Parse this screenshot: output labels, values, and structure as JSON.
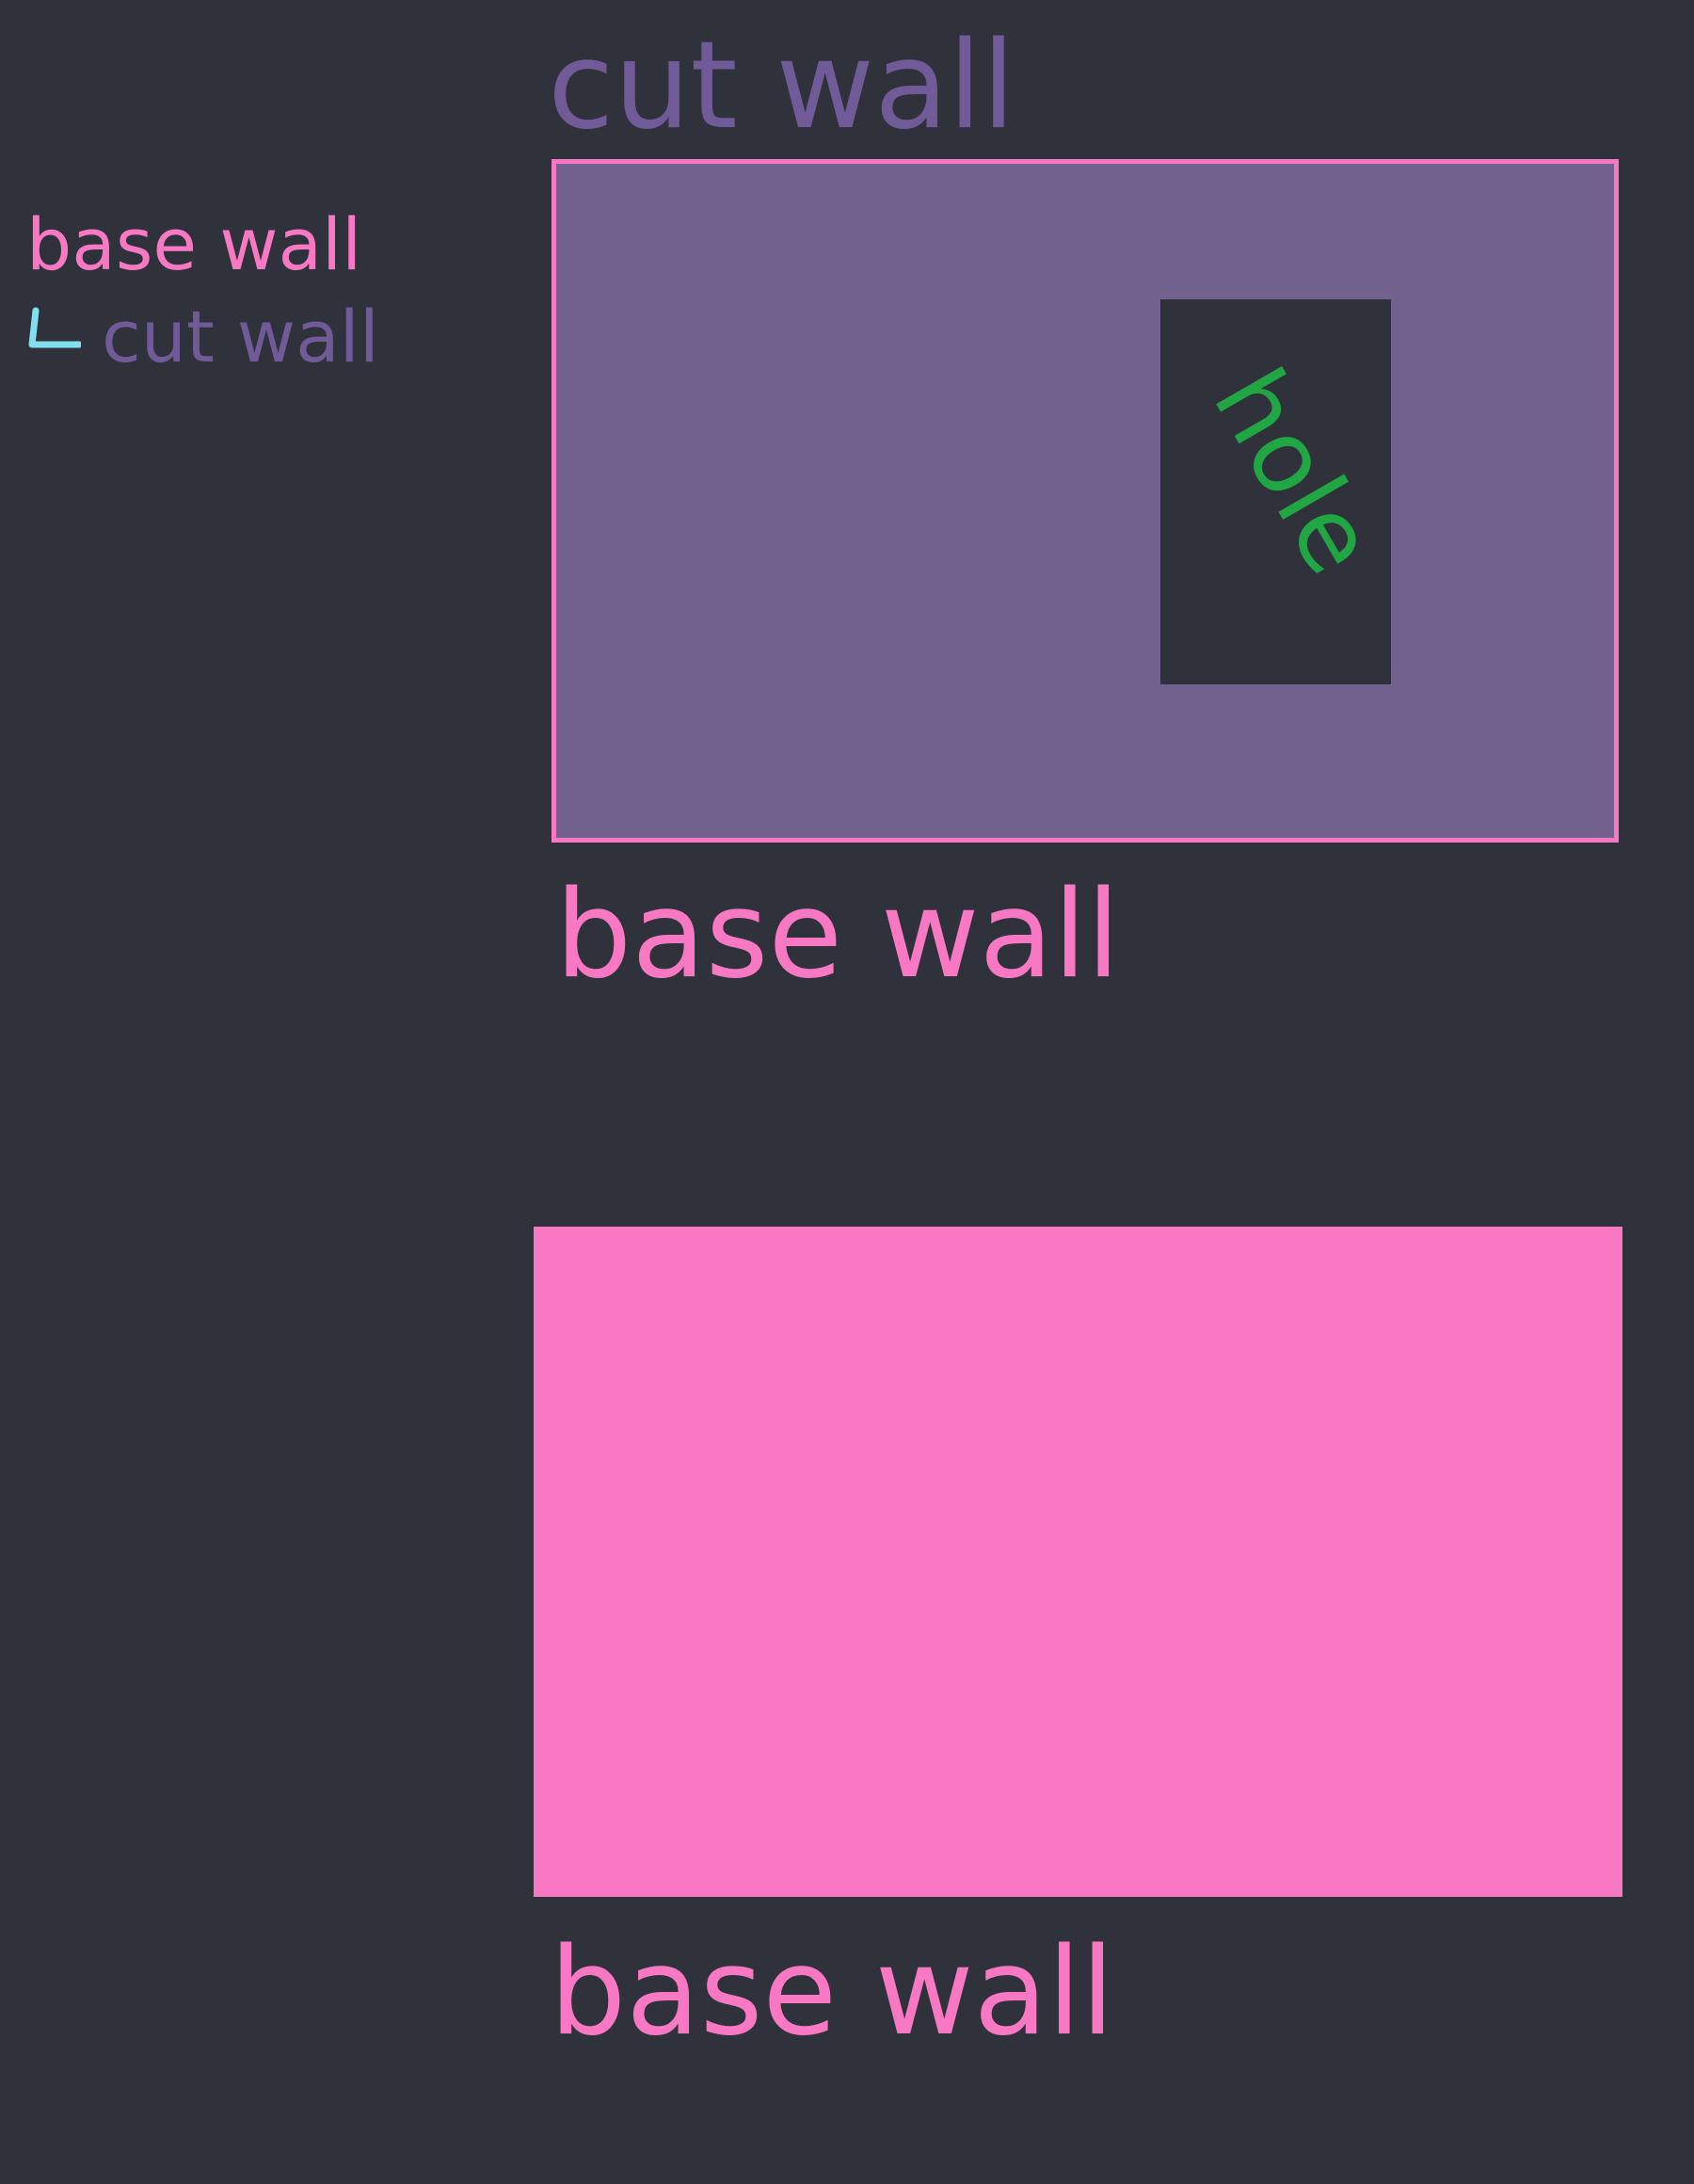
{
  "legend": {
    "parent_label": "base wall",
    "child_label": "cut wall",
    "connector_icon": "tree-branch-icon"
  },
  "top_diagram": {
    "title": "cut wall",
    "hole_label": "hole",
    "caption": "base wall"
  },
  "bottom_diagram": {
    "caption": "base wall"
  },
  "colors": {
    "background": "#2f323a",
    "base_wall": "#f878c3",
    "cut_wall": "#705a98",
    "cut_wall_fill": "#72628f",
    "hole_text": "#21a644",
    "connector": "#80e0f0"
  }
}
